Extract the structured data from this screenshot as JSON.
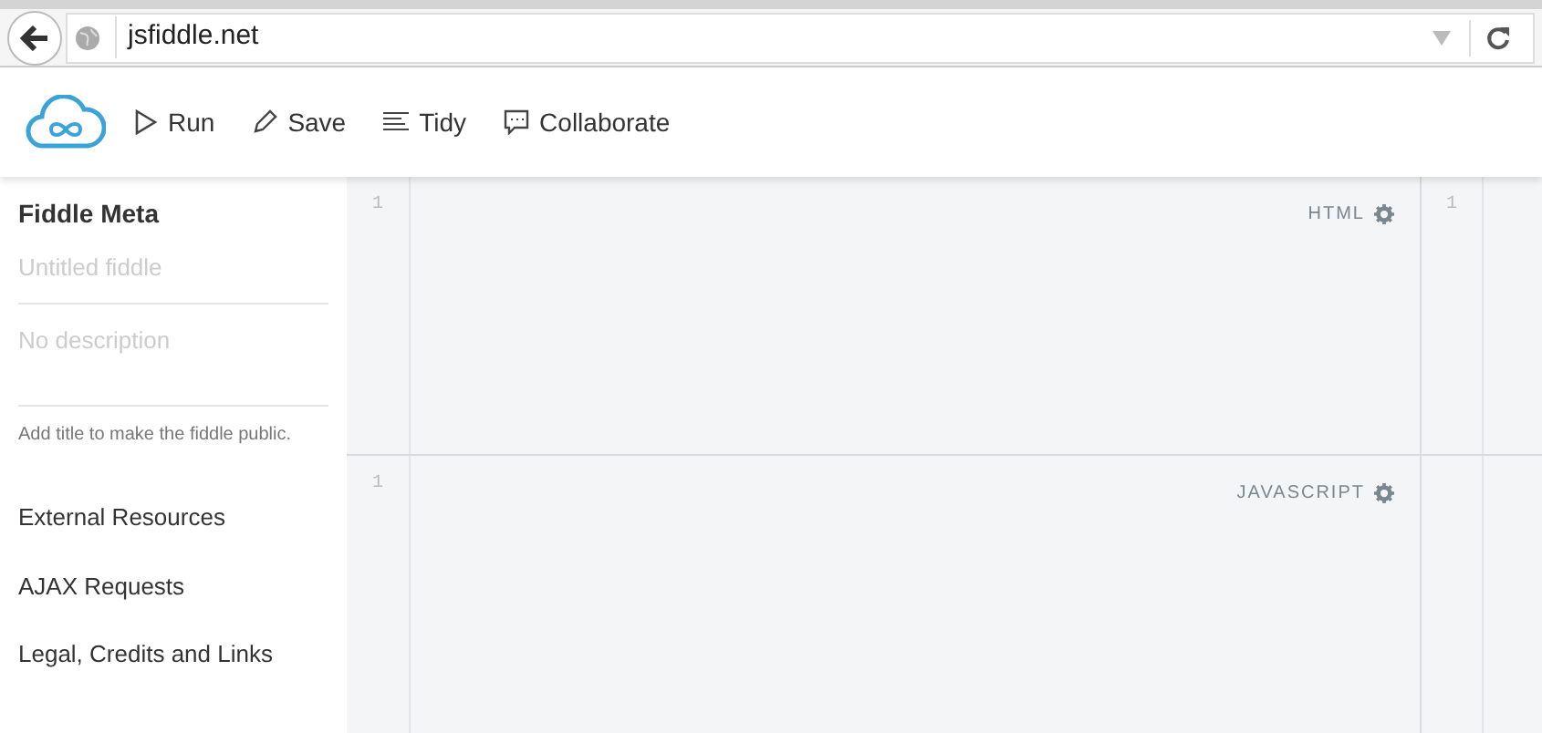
{
  "browser": {
    "url": "jsfiddle.net"
  },
  "toolbar": {
    "buttons": [
      {
        "kind": "run",
        "label": "Run"
      },
      {
        "kind": "save",
        "label": "Save"
      },
      {
        "kind": "tidy",
        "label": "Tidy"
      },
      {
        "kind": "collaborate",
        "label": "Collaborate"
      }
    ]
  },
  "sidebar": {
    "title": "Fiddle Meta",
    "title_field": {
      "placeholder": "Untitled fiddle"
    },
    "description_field": {
      "placeholder": "No description"
    },
    "hint": "Add title to make the fiddle public.",
    "links": [
      "External Resources",
      "AJAX Requests",
      "Legal, Credits and Links"
    ]
  },
  "editors": [
    {
      "label": "HTML",
      "line_numbers": [
        "1"
      ]
    },
    {
      "label": "JAVASCRIPT",
      "line_numbers": [
        "1"
      ]
    }
  ],
  "side_panel": {
    "line_numbers": [
      "1"
    ]
  }
}
